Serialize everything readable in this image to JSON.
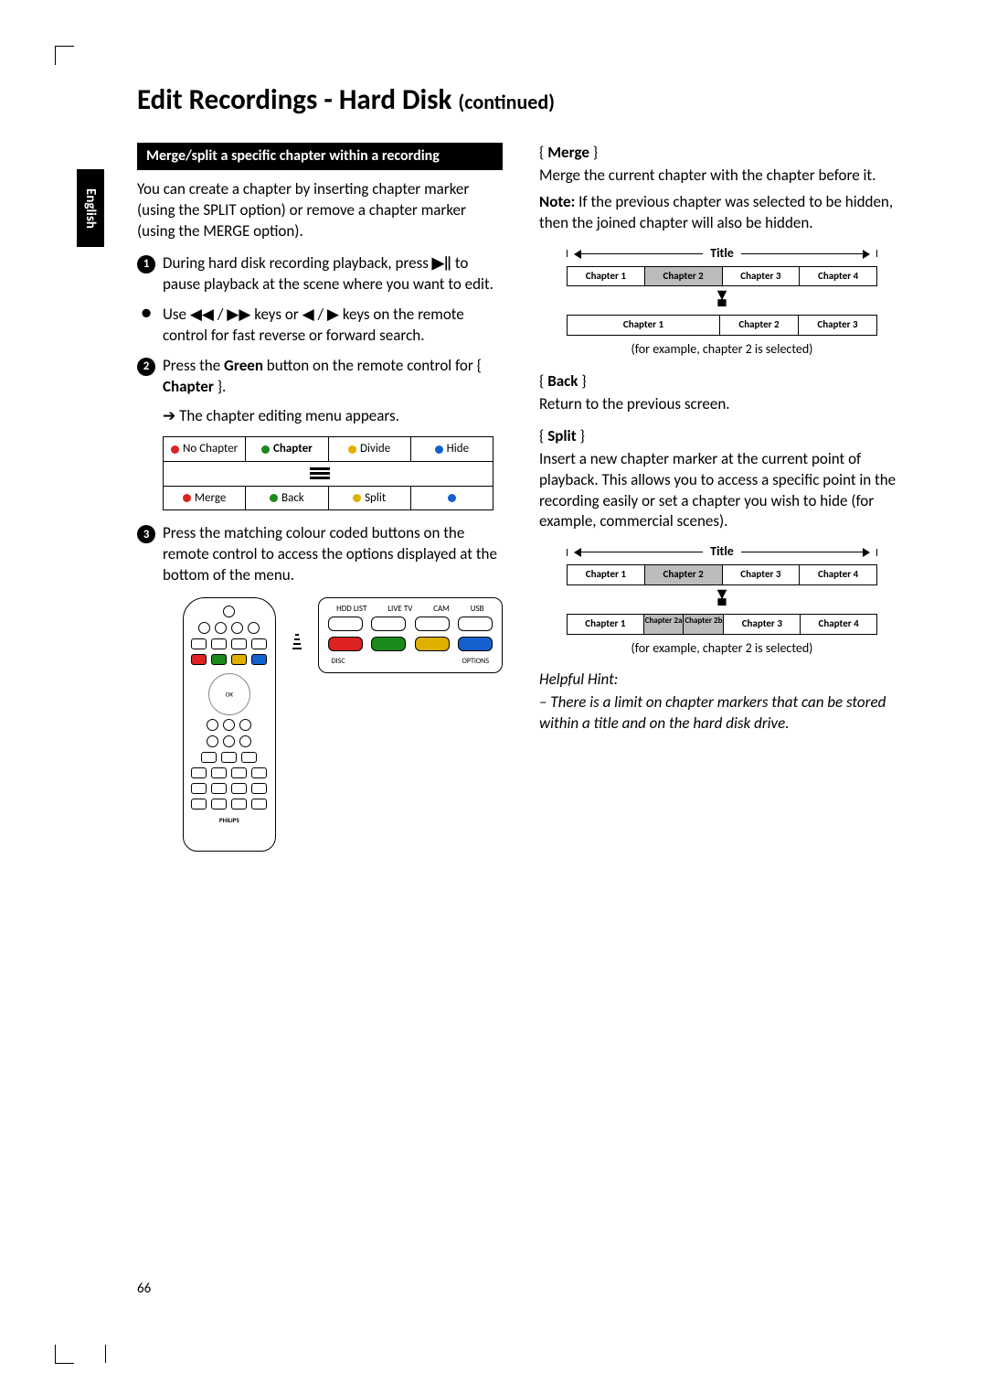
{
  "language_tab": "English",
  "page_title_main": "Edit Recordings - Hard Disk",
  "page_title_cont": "(continued)",
  "page_number": "66",
  "left": {
    "section_bar": "Merge/split a specific chapter within a recording",
    "intro": "You can create a chapter by inserting chapter marker (using the SPLIT option) or remove a chapter marker (using the MERGE option).",
    "step1_a": "During hard disk recording playback, press ",
    "step1_b": " to pause playback at the scene where you want to edit.",
    "bullet_a": "Use ",
    "bullet_b": " keys or ",
    "bullet_c": " keys on the remote control for fast reverse or forward search.",
    "step2_a": "Press the ",
    "step2_green": "Green",
    "step2_b": " button on the remote control for { ",
    "step2_chapter": "Chapter",
    "step2_c": " }.",
    "step2_result": "The chapter editing menu appears.",
    "osd": {
      "no_chapter": "No Chapter",
      "chapter": "Chapter",
      "divide": "Divide",
      "hide": "Hide",
      "merge": "Merge",
      "back": "Back",
      "split": "Split"
    },
    "step3": "Press the matching colour coded buttons on the remote control to access the options displayed at the bottom of the menu.",
    "panel_labels": {
      "a": "HDD LIST",
      "b": "LIVE TV",
      "c": "CAM",
      "d": "USB",
      "disc": "DISC",
      "options": "OPTIONS"
    }
  },
  "right": {
    "merge_label": "Merge",
    "merge_text": "Merge the current chapter with the chapter before it.",
    "merge_note_label": "Note:",
    "merge_note": "  If the previous chapter was selected to be hidden, then the joined chapter will also be hidden.",
    "diag_title": "Title",
    "diag1_top": [
      "Chapter 1",
      "Chapter 2",
      "Chapter 3",
      "Chapter 4"
    ],
    "diag1_bot": [
      "Chapter 1",
      "Chapter 2",
      "Chapter 3"
    ],
    "diag_caption": "(for example, chapter 2 is selected)",
    "back_label": "Back",
    "back_text": "Return to the previous screen.",
    "split_label": "Split",
    "split_text": "Insert a new chapter marker at the current point of playback. This allows you to access a specific point in the recording easily or set a chapter you wish to hide (for example, commercial scenes).",
    "diag2_top": [
      "Chapter 1",
      "Chapter 2",
      "Chapter 3",
      "Chapter 4"
    ],
    "diag2_bot": [
      "Chapter 1",
      "Chapter 2a",
      "Chapter 2b",
      "Chapter 3",
      "Chapter 4"
    ],
    "hint_label": "Helpful Hint:",
    "hint_text": "–  There is a limit on chapter markers that can be stored within a title and on the hard disk drive."
  }
}
